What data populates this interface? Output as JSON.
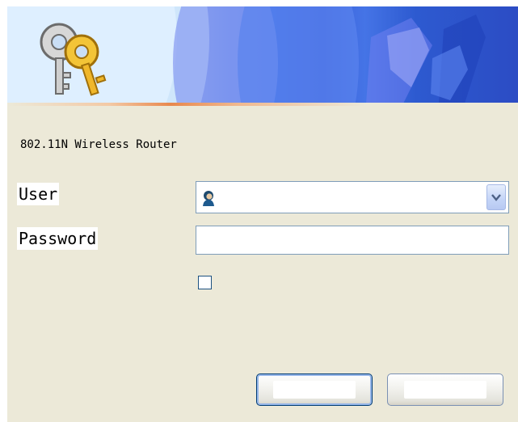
{
  "banner": {
    "keys_icon": "keys-icon",
    "artwork": "network-figure-graphic"
  },
  "product": {
    "name": "802.11N Wireless Router"
  },
  "form": {
    "user_label": "User",
    "user_value": "",
    "user_icon": "user-avatar-icon",
    "password_label": "Password",
    "password_value": "",
    "remember_checked": false
  },
  "buttons": {
    "ok_label": "",
    "cancel_label": ""
  },
  "colors": {
    "dialog_bg": "#ece9d8",
    "field_border": "#7f9db9",
    "button_border": "#003c74"
  }
}
